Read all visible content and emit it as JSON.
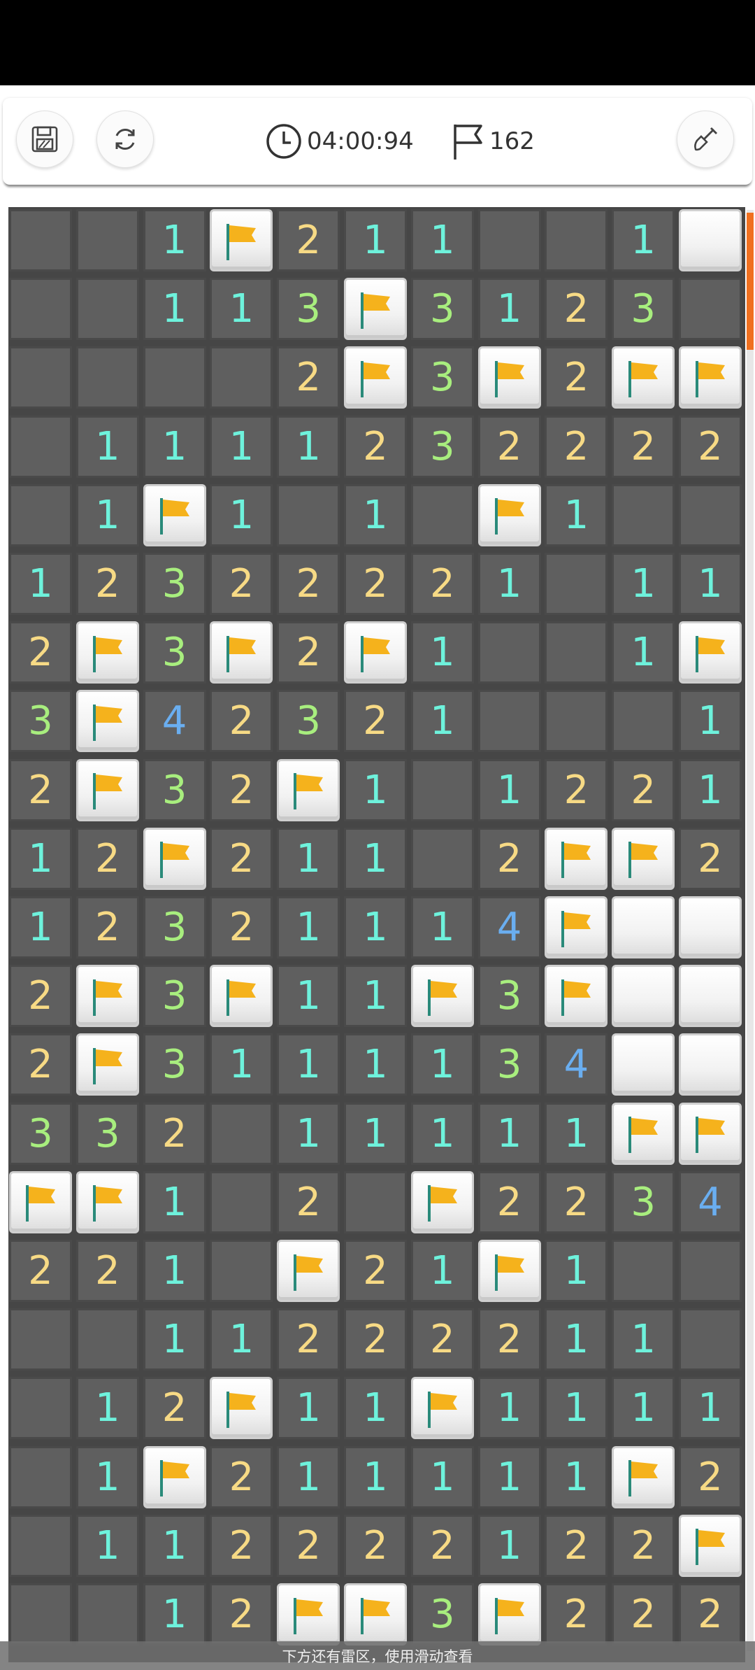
{
  "toolbar": {
    "timer": "04:00:94",
    "flags_remaining": "162",
    "icons": [
      "save-icon",
      "restart-icon",
      "clock-icon",
      "flag-icon",
      "shovel-icon"
    ]
  },
  "board": {
    "columns": 11,
    "visible_rows": 21,
    "legend": "F = flag (closed tile), C = closed tile, 0 = empty revealed, 1-4 = number",
    "rows": [
      "001F21100 1C",
      "00113F31230C",
      "00002F3F2FF",
      "01111232222",
      "01F1010F1000",
      "12322221011",
      "2F3F2F1001F",
      "3F4232100011",
      "2F32F101221",
      "12F21102FF2",
      "12321114FCC",
      "2F3F11F3FCC",
      "2F31111 34CC",
      "332011111FFF",
      "FF1020F2234 2",
      "2210F21F10",
      "00112222110",
      "012F11F1111",
      "01F21111 1F2",
      "01122221 22F",
      "0012FF3F222"
    ],
    "colors": {
      "1": "#6ef2dc",
      "2": "#f7da85",
      "3": "#a8ee7e",
      "4": "#6aaef0",
      "flag": "#f5b21c"
    }
  },
  "hint": "下方还有雷区，使用滑动查看"
}
